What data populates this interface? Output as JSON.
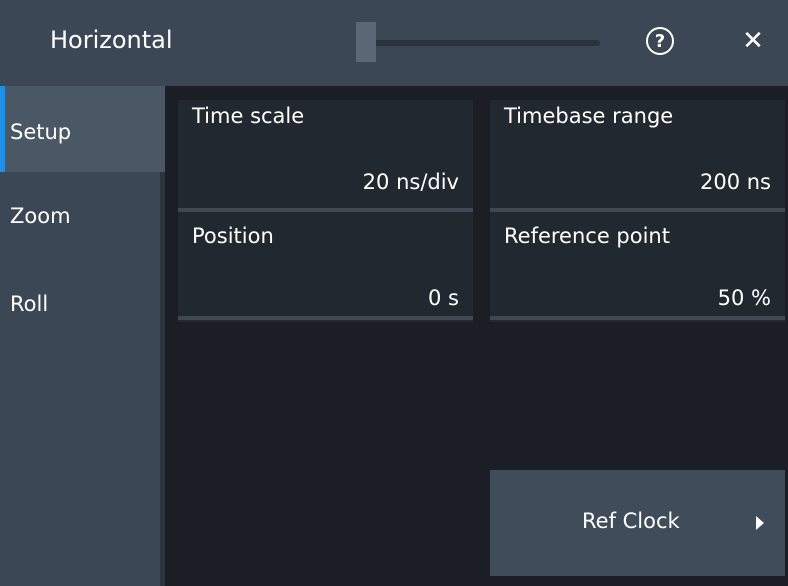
{
  "dialog": {
    "title": "Horizontal",
    "help_symbol": "?",
    "close_symbol": "✕"
  },
  "sidebar": {
    "items": [
      {
        "label": "Setup",
        "active": true
      },
      {
        "label": "Zoom",
        "active": false
      },
      {
        "label": "Roll",
        "active": false
      }
    ]
  },
  "fields": {
    "time_scale": {
      "label": "Time scale",
      "value": "20 ns/div"
    },
    "timebase_range": {
      "label": "Timebase range",
      "value": "200 ns"
    },
    "position": {
      "label": "Position",
      "value": "0 s"
    },
    "reference_point": {
      "label": "Reference point",
      "value": "50 %"
    }
  },
  "ref_clock": {
    "label": "Ref Clock",
    "icon": "chevron-right-icon"
  },
  "colors": {
    "accent": "#1e90e6",
    "titlebar": "#3b4754",
    "background": "#1b1f25",
    "button": "#3f4c59"
  }
}
